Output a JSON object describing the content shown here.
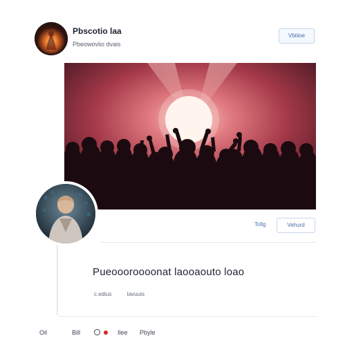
{
  "header": {
    "name": "Pbscotio laa",
    "subtitle": "Pbeowoviio dvais",
    "follow_label": "Vbiiioe"
  },
  "post": {
    "small_link": "Tollg",
    "reply_label": "Vehurd"
  },
  "comment": {
    "text": "Pueoooroooonat laooaouto loao",
    "meta": [
      "c.edius",
      "Iavuuis"
    ]
  },
  "footer": {
    "items": [
      "Oil",
      "Bill",
      "Ilee",
      "Pbyle"
    ]
  },
  "colors": {
    "accent": "#4a6fa8",
    "notification": "#d8242a",
    "image_glow": "#f3a9a0",
    "image_background": "#6d2a36"
  },
  "icons": {
    "footer_circle": "circle-outline-icon",
    "footer_dot": "notification-dot-icon"
  }
}
